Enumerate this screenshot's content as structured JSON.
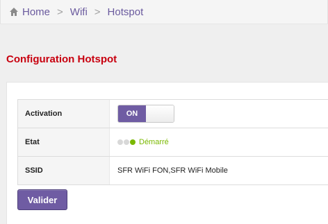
{
  "breadcrumb": {
    "home_label": "Home",
    "separator": ">",
    "items": [
      "Wifi",
      "Hotspot"
    ]
  },
  "page": {
    "title": "Configuration Hotspot"
  },
  "config": {
    "activation_label": "Activation",
    "activation_toggle": "ON",
    "state_label": "Etat",
    "state_value": "Démarré",
    "ssid_label": "SSID",
    "ssid_value": "SFR WiFi FON,SFR WiFi Mobile"
  },
  "actions": {
    "validate_label": "Valider"
  },
  "colors": {
    "accent": "#6f5ca3",
    "title_red": "#c8000f",
    "status_green": "#7ab800"
  },
  "icons": {
    "home": "home-icon"
  }
}
